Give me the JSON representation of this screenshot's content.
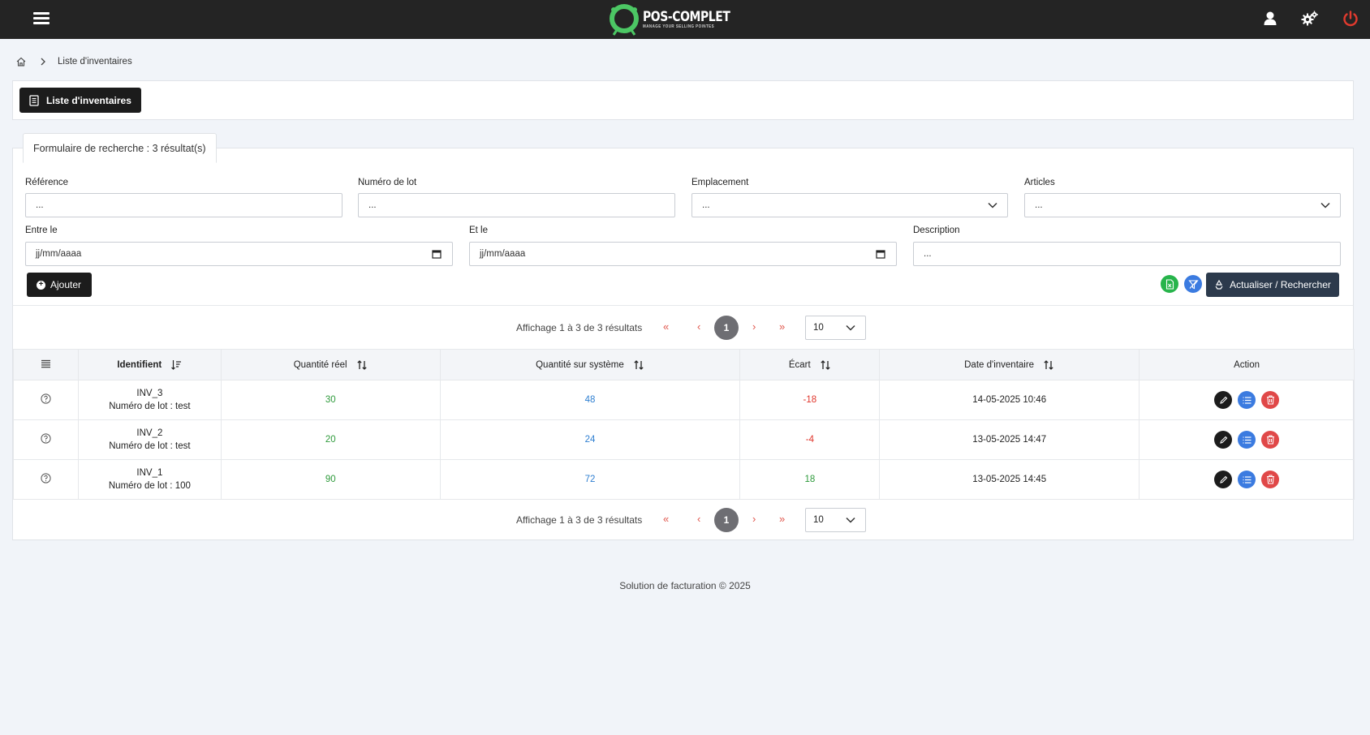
{
  "header": {
    "logo_title": "POS-COMPLET",
    "logo_subtitle": "MANAGE YOUR SELLING POINTES"
  },
  "breadcrumb": {
    "current": "Liste d'inventaires"
  },
  "page": {
    "title_button": "Liste d'inventaires"
  },
  "search": {
    "tab_label": "Formulaire de recherche : 3 résultat(s)",
    "fields": {
      "reference": {
        "label": "Référence",
        "placeholder": "..."
      },
      "numero_lot": {
        "label": "Numéro de lot",
        "placeholder": "..."
      },
      "emplacement": {
        "label": "Emplacement",
        "value": "..."
      },
      "articles": {
        "label": "Articles",
        "value": "..."
      },
      "entre_le": {
        "label": "Entre le",
        "value": "jj/mm/aaaa"
      },
      "et_le": {
        "label": "Et le",
        "value": "jj/mm/aaaa"
      },
      "description": {
        "label": "Description",
        "placeholder": "..."
      }
    },
    "add_button": "Ajouter",
    "refresh_button": "Actualiser / Rechercher"
  },
  "pagination": {
    "info": "Affichage 1 à 3 de 3 résultats",
    "first": "«",
    "prev": "‹",
    "current_page": "1",
    "next": "›",
    "last": "»",
    "page_size": "10"
  },
  "table": {
    "columns": [
      "Identifient",
      "Quantité réel",
      "Quantité sur système",
      "Écart",
      "Date d'inventaire",
      "Action"
    ],
    "rows": [
      {
        "id": "INV_3",
        "lot": "Numéro de lot : test",
        "qte_reel": "30",
        "qte_systeme": "48",
        "ecart": "-18",
        "date": "14-05-2025 10:46"
      },
      {
        "id": "INV_2",
        "lot": "Numéro de lot : test",
        "qte_reel": "20",
        "qte_systeme": "24",
        "ecart": "-4",
        "date": "13-05-2025 14:47"
      },
      {
        "id": "INV_1",
        "lot": "Numéro de lot : 100",
        "qte_reel": "90",
        "qte_systeme": "72",
        "ecart": "18",
        "date": "13-05-2025 14:45"
      }
    ]
  },
  "footer": {
    "text": "Solution de facturation © 2025"
  },
  "colors": {
    "topbar": "#242424",
    "positive": "#2e9a3b",
    "system": "#2f7fd1",
    "negative": "#e0352b",
    "edit": "#1c1c1c",
    "details": "#3b7be0",
    "delete": "#e04848",
    "export": "#27b44b",
    "filter": "#3b7be0"
  }
}
